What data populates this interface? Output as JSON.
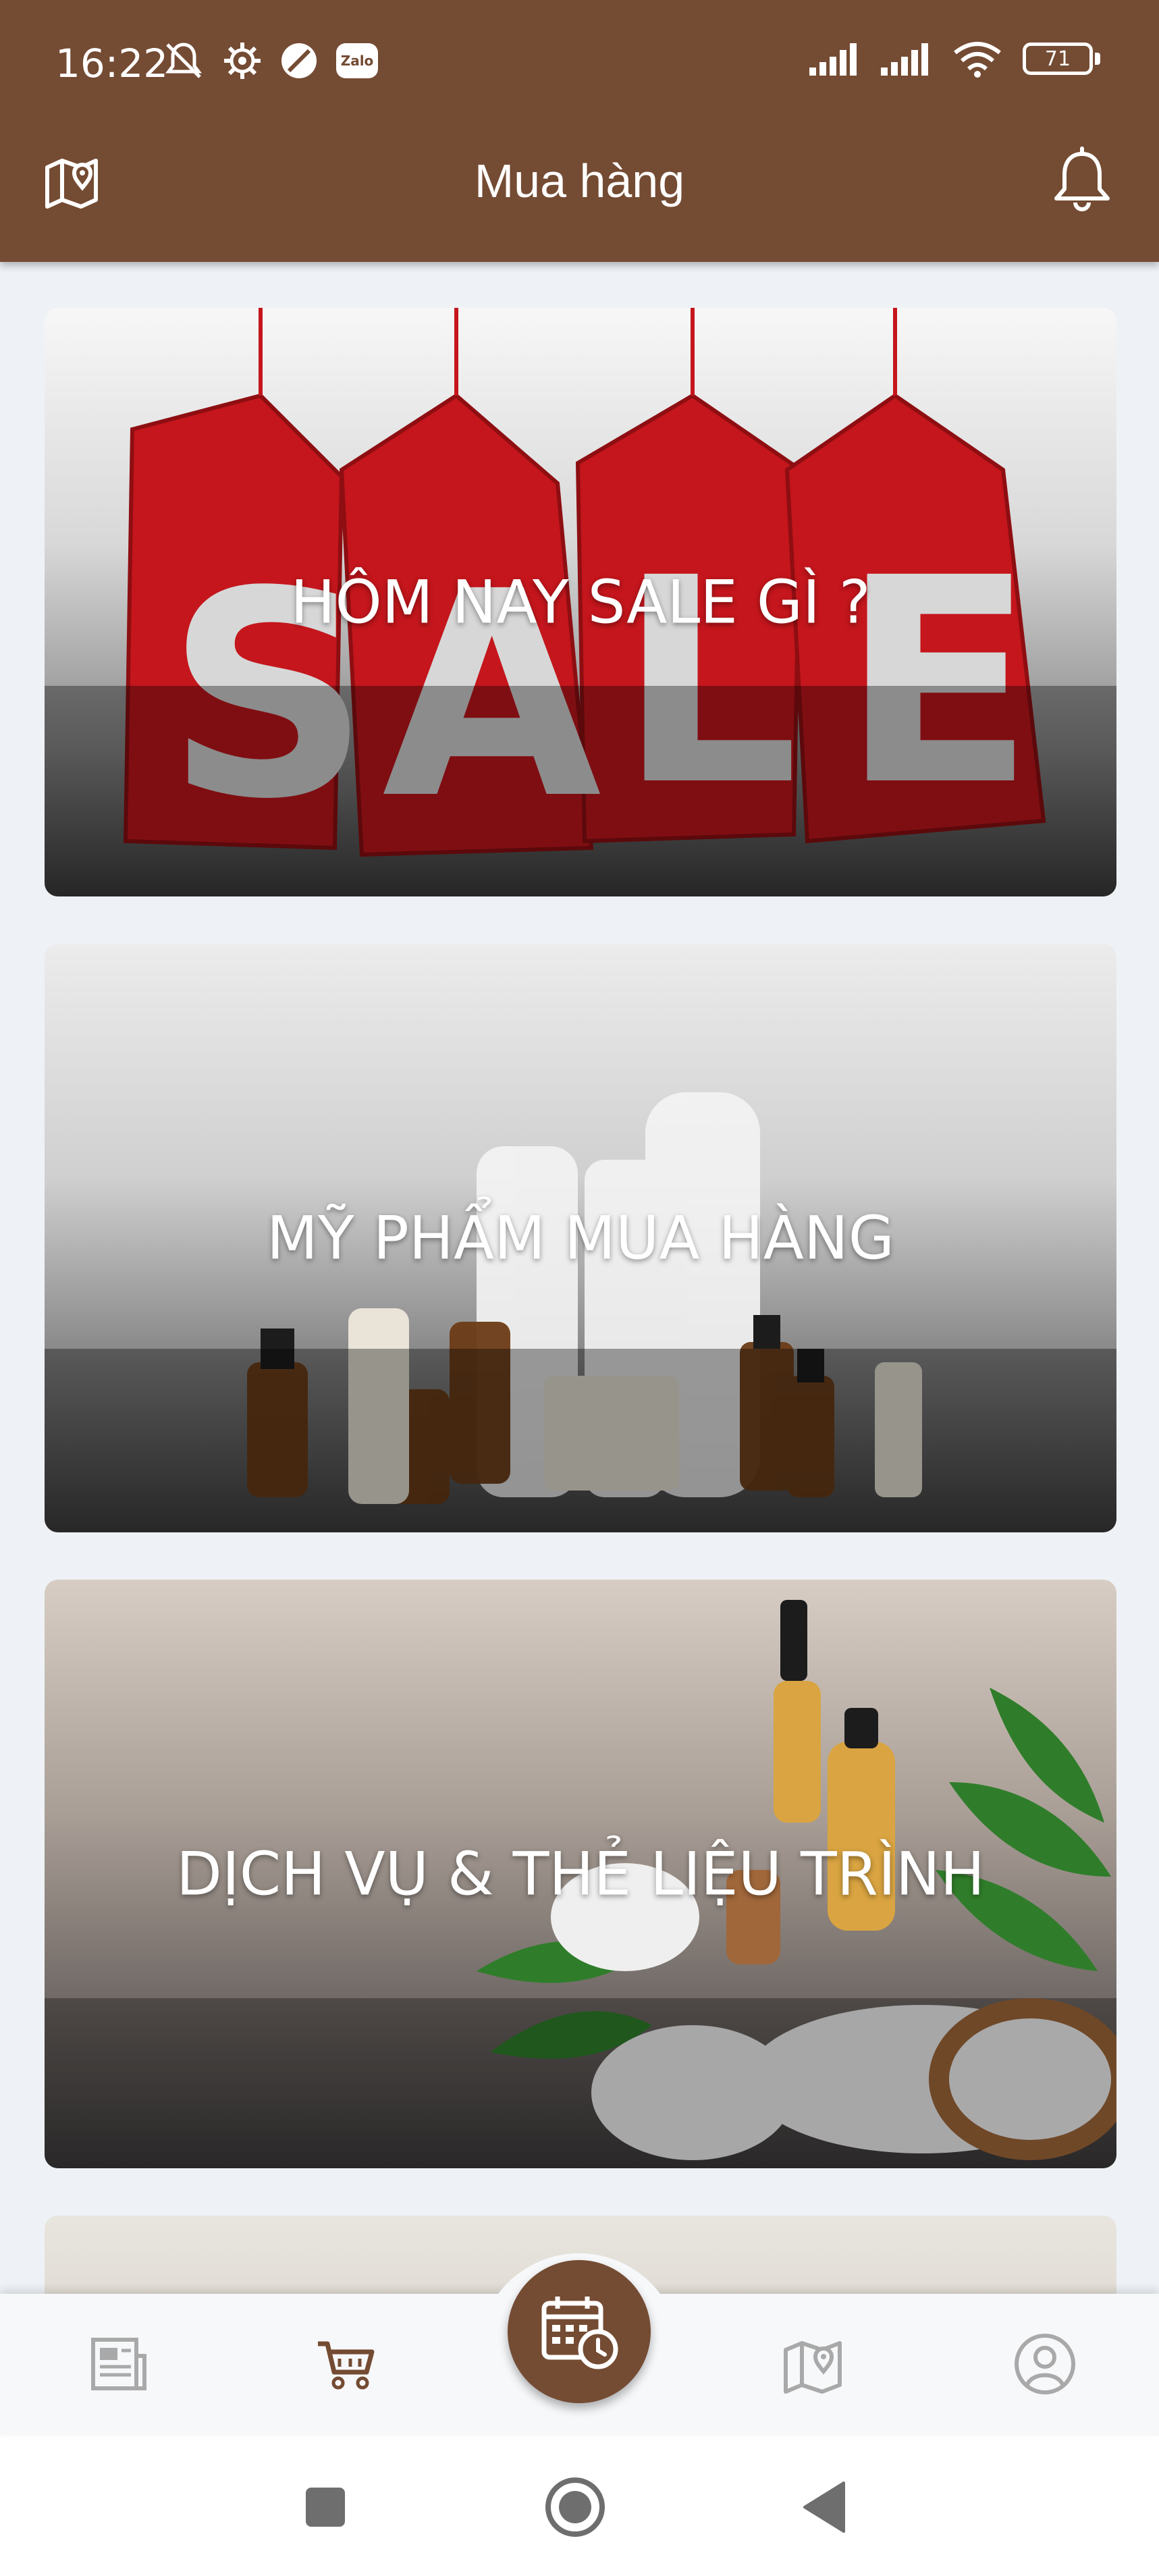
{
  "status_bar": {
    "time": "16:22",
    "left_icons": [
      "mute-icon",
      "settings-gear-icon",
      "circle-slash-icon",
      "zalo-icon"
    ],
    "zalo_label": "Zalo",
    "battery_level": "71"
  },
  "app_bar": {
    "title": "Mua hàng",
    "left_icon": "map-pin-icon",
    "right_icon": "bell-icon"
  },
  "categories": [
    {
      "label": "HÔM NAY SALE GÌ ?"
    },
    {
      "label": "MỸ PHẨM MUA HÀNG"
    },
    {
      "label": "DỊCH VỤ & THẺ LIỆU TRÌNH"
    },
    {
      "label": ""
    }
  ],
  "bottom_nav": {
    "items": [
      {
        "icon": "newspaper-icon",
        "active": false
      },
      {
        "icon": "cart-icon",
        "active": true
      },
      {
        "icon": "calendar-clock-icon",
        "active": false
      },
      {
        "icon": "map-icon",
        "active": false
      },
      {
        "icon": "profile-icon",
        "active": false
      }
    ]
  },
  "colors": {
    "brand": "#744b33",
    "inactive_icon": "#a9a9a9",
    "background": "#eef2f6"
  }
}
